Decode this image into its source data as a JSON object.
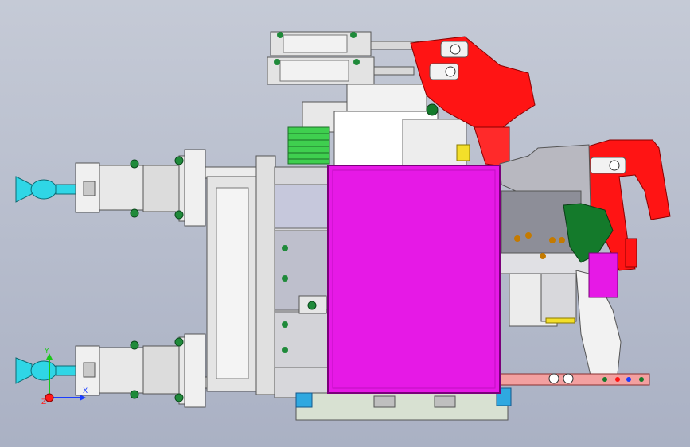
{
  "viewport": {
    "background_top": "#c5cad6",
    "background_bottom": "#aab1c4"
  },
  "colors": {
    "cylinder": "#e6e6e6",
    "nozzle_cyan": "#2fd6e6",
    "clamp_red": "#ff1414",
    "mold_block": "#e619e6",
    "heat_sink_green": "#3fcf4f",
    "dark_green": "#147a2b",
    "plate_gray": "#d0d0d4",
    "axis_x": "#1a3cff",
    "axis_y": "#19c619",
    "axis_z": "#ff1a1a"
  },
  "triad": {
    "x_axis": "X",
    "y_axis": "Y",
    "z_axis": "Z"
  }
}
